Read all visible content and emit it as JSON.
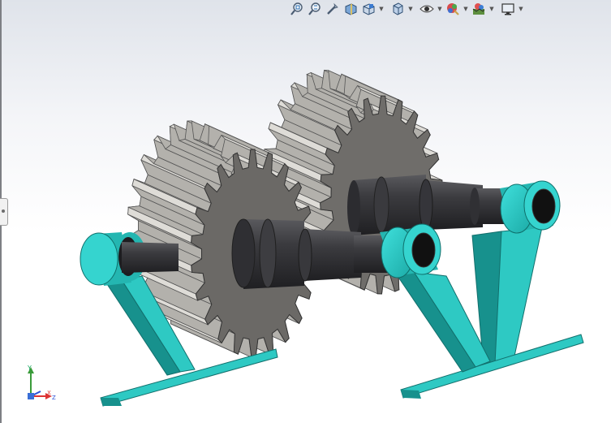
{
  "toolbar": {
    "icons": [
      "zoom-to-fit-icon",
      "zoom-to-area-icon",
      "previous-view-icon",
      "section-view-icon",
      "view-orientation-icon",
      "display-style-icon",
      "hide-show-items-icon",
      "edit-appearance-icon",
      "apply-scene-icon",
      "view-settings-icon"
    ]
  },
  "model": {
    "colors": {
      "support": "#2ec9c3",
      "support_dark": "#17918d",
      "bearing": "#2fd3cf",
      "gear_face": "#6d6b68",
      "gear_teeth": "#bfbdb8",
      "shaft": "#3f3f42",
      "bore": "#111111"
    }
  },
  "triad": {
    "x_label": "X",
    "y_label": "Y",
    "z_label": "Z"
  }
}
